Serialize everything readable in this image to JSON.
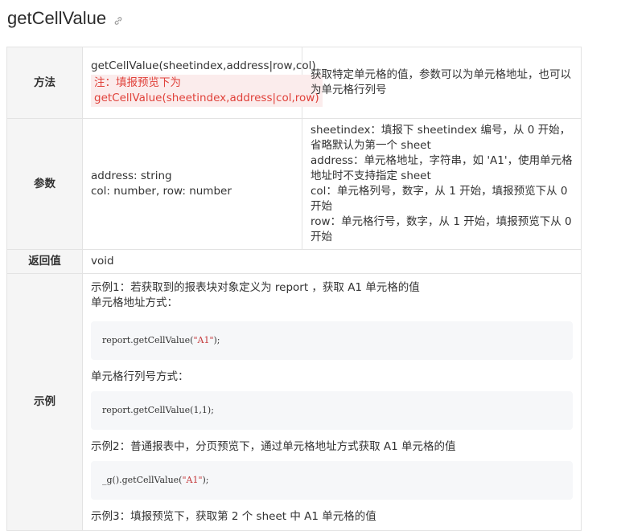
{
  "title": "getCellValue",
  "table": {
    "method": {
      "header": "方法",
      "signature": "getCellValue(sheetindex,address|row,col)",
      "note": "注：填报预览下为 getCellValue(sheetindex,address|col,row)",
      "description": "获取特定单元格的值，参数可以为单元格地址，也可以为单元格行列号"
    },
    "params": {
      "header": "参数",
      "line1": "address: string",
      "line2": "col: number, row: number",
      "descriptions": [
        "sheetindex：填报下 sheetindex 编号，从 0 开始，省略默认为第一个 sheet",
        "address：单元格地址，字符串，如 'A1'，使用单元格地址时不支持指定 sheet",
        "col：单元格列号，数字，从 1 开始，填报预览下从 0 开始",
        "row：单元格行号，数字，从 1 开始，填报预览下从 0 开始"
      ]
    },
    "return": {
      "header": "返回值",
      "value": "void"
    },
    "example": {
      "header": "示例",
      "ex1_title": "示例1：若获取到的报表块对象定义为 report ，获取 A1 单元格的值",
      "ex1_sub1": "单元格地址方式：",
      "code1_pre": "report.getCellValue(",
      "code1_str": "\"A1\"",
      "code1_post": ");",
      "ex1_sub2": "单元格行列号方式：",
      "code2": "report.getCellValue(1,1);",
      "ex2_title": "示例2：普通报表中，分页预览下，通过单元格地址方式获取 A1 单元格的值",
      "code3_pre": "_g().getCellValue(",
      "code3_str": "\"A1\"",
      "code3_post": ");",
      "ex3_title": "示例3：填报预览下，获取第 2 个 sheet 中 A1 单元格的值"
    }
  }
}
